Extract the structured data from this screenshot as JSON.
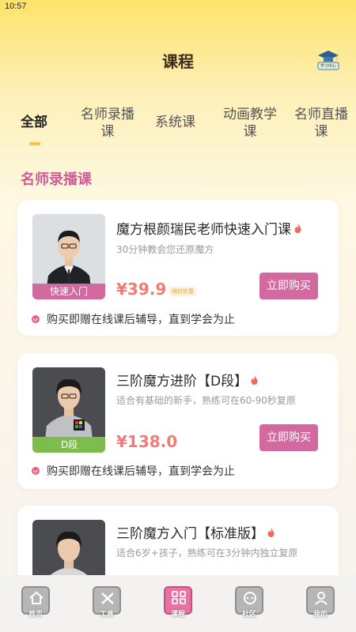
{
  "status_bar": {
    "time": "10:57"
  },
  "header": {
    "title": "课程",
    "study_center_label": "学习中心"
  },
  "tabs": [
    {
      "label": "全部",
      "active": true
    },
    {
      "label": "名师录播课",
      "active": false
    },
    {
      "label": "系统课",
      "active": false
    },
    {
      "label": "动画教学课",
      "active": false
    },
    {
      "label": "名师直播课",
      "active": false
    }
  ],
  "section": {
    "title": "名师录播课"
  },
  "courses": [
    {
      "badge": "快速入门",
      "title": "魔方根颜瑞民老师快速入门课",
      "subtitle": "30分钟教会您还原魔方",
      "price": "¥39.9",
      "price_tag": "限时优惠",
      "buy_label": "立即购买",
      "bonus": "购买即赠在线课后辅导，直到学会为止"
    },
    {
      "badge": "D段",
      "title": "三阶魔方进阶【D段】",
      "subtitle": "适合有基础的新手，熟练可在60-90秒复原",
      "price": "¥138.0",
      "buy_label": "立即购买",
      "bonus": "购买即赠在线课后辅导，直到学会为止"
    },
    {
      "title": "三阶魔方入门【标准版】",
      "subtitle": "适合6岁+孩子，熟练可在3分钟内独立复原"
    }
  ],
  "bottom_nav": [
    {
      "label": "首页",
      "icon": "home-icon"
    },
    {
      "label": "工具",
      "icon": "tools-icon"
    },
    {
      "label": "课程",
      "icon": "course-icon",
      "active": true
    },
    {
      "label": "社区",
      "icon": "community-icon"
    },
    {
      "label": "我的",
      "icon": "profile-icon"
    }
  ],
  "colors": {
    "accent": "#d26aa0",
    "price": "#ef7d77",
    "section_title": "#cf5e97",
    "tab_indicator": "#f6c53c"
  }
}
